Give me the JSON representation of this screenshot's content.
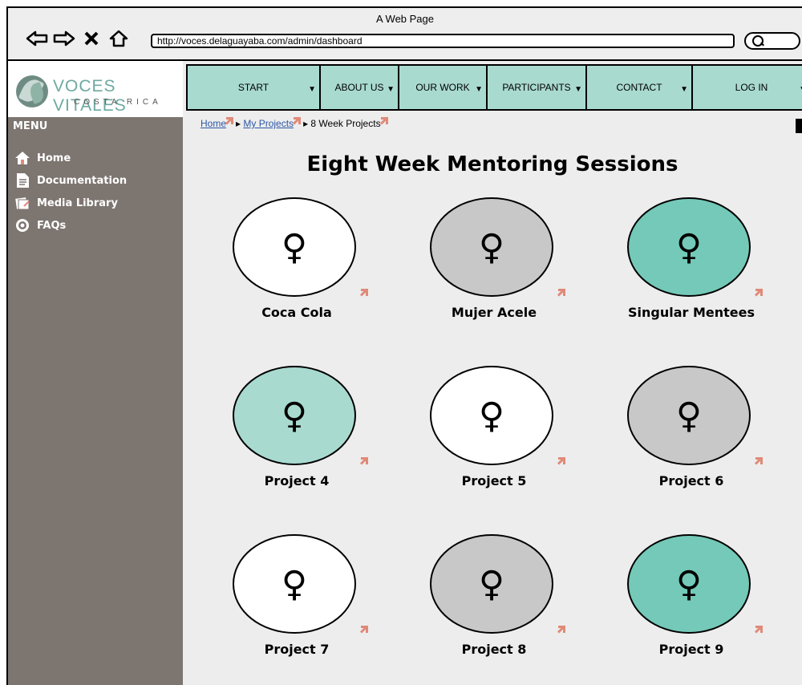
{
  "window": {
    "title": "A Web Page",
    "url": "http://voces.delaguayaba.com/admin/dashboard"
  },
  "logo": {
    "name": "VOCES VITALES",
    "sub": "COSTA RICA"
  },
  "nav": [
    {
      "label": "START"
    },
    {
      "label": "ABOUT US"
    },
    {
      "label": "OUR WORK"
    },
    {
      "label": "PARTICIPANTS"
    },
    {
      "label": "CONTACT"
    },
    {
      "label": "LOG IN"
    }
  ],
  "sidebar": {
    "title": "MENU",
    "items": [
      {
        "label": "Home",
        "icon": "home-icon"
      },
      {
        "label": "Documentation",
        "icon": "document-icon"
      },
      {
        "label": "Media Library",
        "icon": "media-library-icon"
      },
      {
        "label": "FAQs",
        "icon": "help-icon"
      }
    ]
  },
  "breadcrumb": {
    "home": "Home",
    "projects": "My Projects",
    "current": "8 Week Projects"
  },
  "page": {
    "title": "Eight Week Mentoring Sessions"
  },
  "cards": [
    {
      "label": "Coca Cola",
      "color": "#ffffff"
    },
    {
      "label": "Mujer Acele",
      "color": "#c8c8c8"
    },
    {
      "label": "Singular Mentees",
      "color": "#74c9b8"
    },
    {
      "label": "Project 4",
      "color": "#a8dad0"
    },
    {
      "label": "Project 5",
      "color": "#ffffff"
    },
    {
      "label": "Project 6",
      "color": "#c8c8c8"
    },
    {
      "label": "Project 7",
      "color": "#ffffff"
    },
    {
      "label": "Project 8",
      "color": "#c8c8c8"
    },
    {
      "label": "Project 9",
      "color": "#74c9b8"
    }
  ],
  "icons": {
    "female": "♀"
  }
}
